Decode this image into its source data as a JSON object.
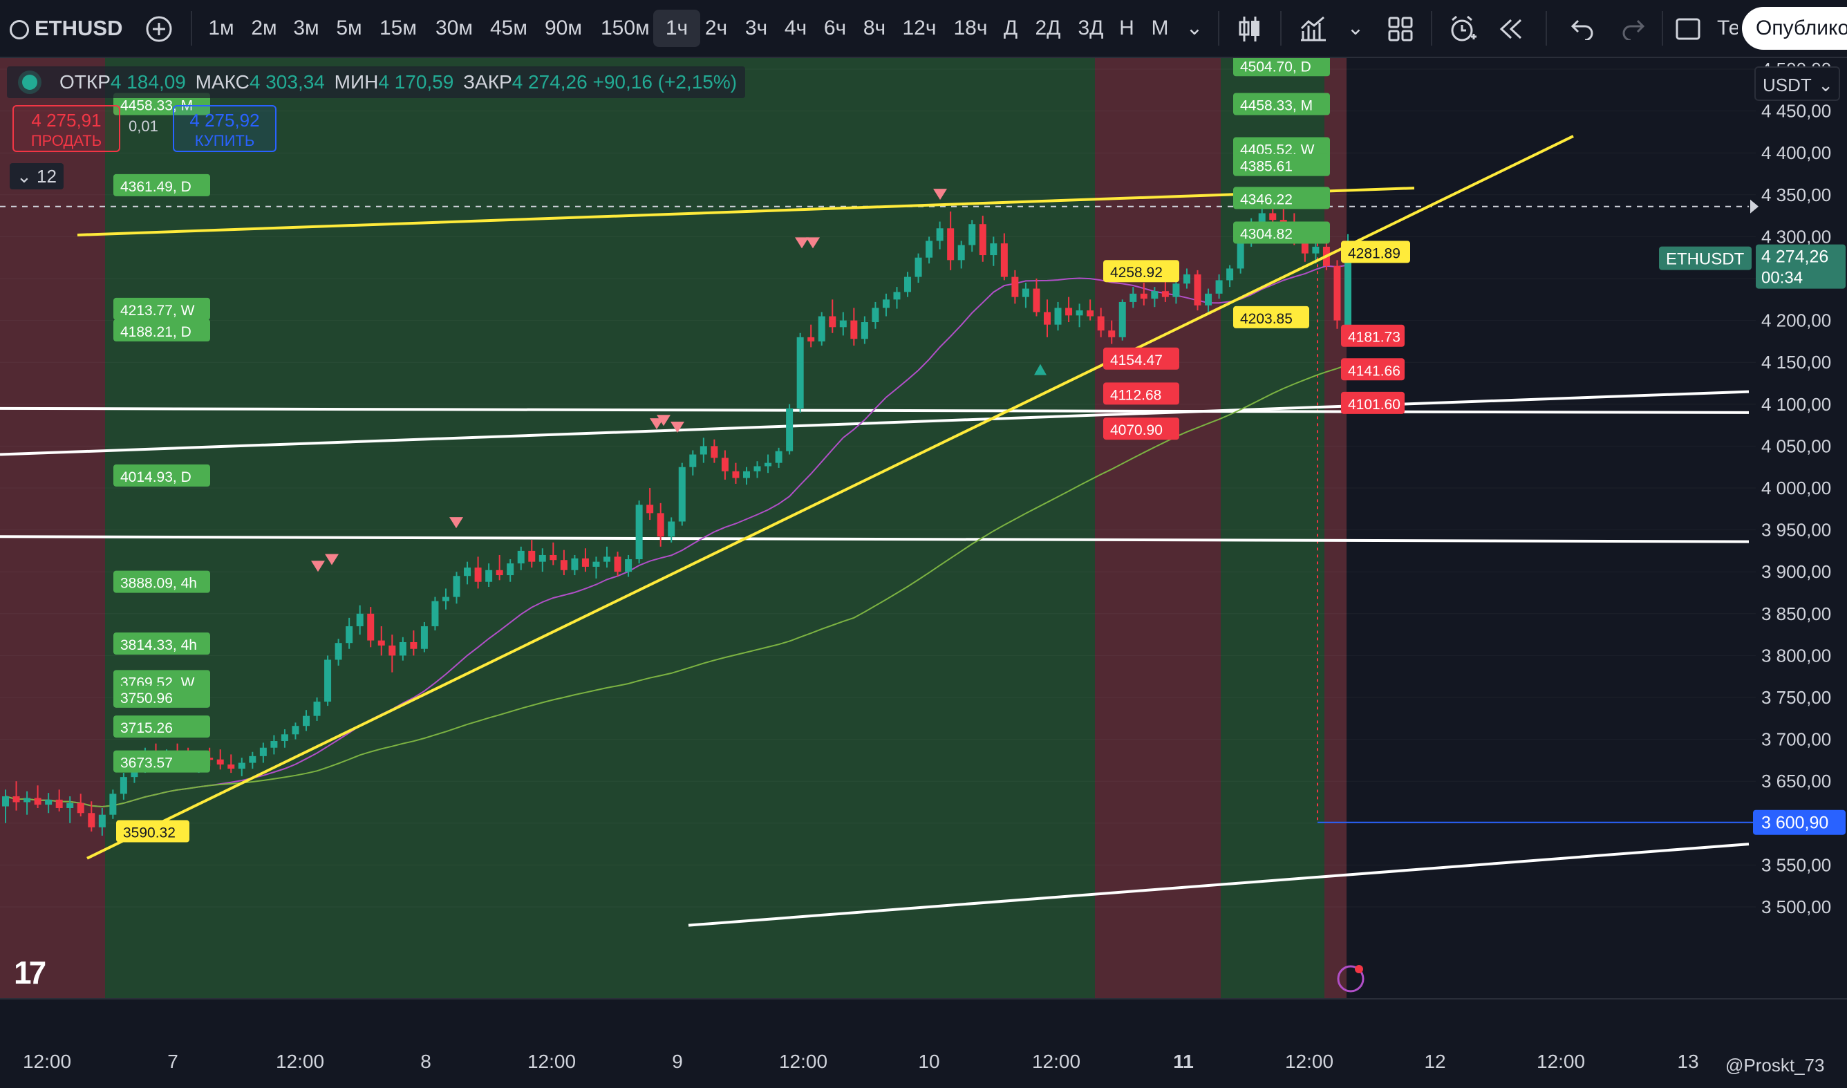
{
  "toolbar": {
    "symbol": "ETHUSD",
    "add_symbol_icon": "plus-circle-icon",
    "intervals": [
      "1м",
      "2м",
      "3м",
      "5м",
      "15м",
      "30м",
      "45м",
      "90м",
      "150м",
      "1ч",
      "2ч",
      "3ч",
      "4ч",
      "6ч",
      "8ч",
      "12ч",
      "18ч",
      "Д",
      "2Д",
      "3Д",
      "Н",
      "М"
    ],
    "active_interval": "1ч",
    "interval_dropdown_icon": "chevron-down-icon",
    "chart_type_icon": "candles-icon",
    "indicators_icon": "indicators-icon",
    "layout_icon": "grid-layout-icon",
    "alert_icon": "alarm-plus-icon",
    "replay_icon": "rewind-icon",
    "undo_icon": "undo-icon",
    "redo_icon": "redo-icon",
    "fullscreen_icon": "square-icon",
    "truncated_label": "Те",
    "publish_label": "Опубликовать"
  },
  "legend": {
    "open_label": "ОТКР",
    "open": "4 184,09",
    "high_label": "МАКС",
    "high": "4 303,34",
    "low_label": "МИН",
    "low": "4 170,59",
    "close_label": "ЗАКР",
    "close": "4 274,26",
    "change": "+90,16 (+2,15%)"
  },
  "trade": {
    "sell_price": "4 275,91",
    "sell_label": "ПРОДАТЬ",
    "lot": "0,01",
    "buy_price": "4 275,92",
    "buy_label": "КУПИТЬ"
  },
  "indicators_toggle": "12",
  "currency": "USDT",
  "watermark": "@Proskt_73",
  "colors": {
    "bg": "#131722",
    "up": "#22ab94",
    "down": "#f23645",
    "trendline": "#ffeb3b",
    "level": "#ffffff",
    "zone_green": "#244a30",
    "zone_red": "#5a2b35",
    "label_green": "#4caf50",
    "label_red": "#f23645",
    "label_yellow": "#ffeb3b",
    "ma_purple": "#b14fc8",
    "ma_green": "#7cb342",
    "blue_line": "#2962ff"
  },
  "chart_data": {
    "type": "candlestick",
    "symbol": "ETHUSD",
    "interval": "1ч",
    "ylim": [
      3480,
      4530
    ],
    "y_ticks": [
      "4 500,00",
      "4 450,00",
      "4 400,00",
      "4 350,00",
      "4 300,00",
      "4 250,00",
      "4 200,00",
      "4 150,00",
      "4 100,00",
      "4 050,00",
      "4 000,00",
      "3 950,00",
      "3 900,00",
      "3 850,00",
      "3 800,00",
      "3 750,00",
      "3 700,00",
      "3 650,00",
      "3 600,00",
      "3 550,00",
      "3 500,00"
    ],
    "x_ticks": [
      "12:00",
      "7",
      "12:00",
      "8",
      "12:00",
      "9",
      "12:00",
      "10",
      "12:00",
      "11",
      "12:00",
      "12",
      "12:00",
      "13"
    ],
    "current_price": {
      "symbol": "ETHUSDT",
      "value": "4 274,26",
      "timer": "00:34"
    },
    "blue_level": {
      "value": 3600.9,
      "label": "3 600,90"
    },
    "dashed_level": 4336,
    "level_labels_green_left": [
      {
        "text": "4458.33, M",
        "value": 4458.33
      },
      {
        "text": "4361.49, D",
        "value": 4361.49
      },
      {
        "text": "4213.77, W",
        "value": 4213.77
      },
      {
        "text": "4188.21, D",
        "value": 4188.21
      },
      {
        "text": "4014.93, D",
        "value": 4014.93
      },
      {
        "text": "3888.09, 4h",
        "value": 3888.09
      },
      {
        "text": "3814.33, 4h",
        "value": 3814.33
      },
      {
        "text": "3769.52, W",
        "value": 3769.52
      },
      {
        "text": "3750.96",
        "value": 3750.96
      },
      {
        "text": "3715.26",
        "value": 3715.26
      },
      {
        "text": "3673.57",
        "value": 3673.57
      }
    ],
    "level_labels_green_right": [
      {
        "text": "4504.70, D",
        "value": 4504.7
      },
      {
        "text": "4458.33, M",
        "value": 4458.33
      },
      {
        "text": "4405.52, W",
        "value": 4405.52
      },
      {
        "text": "4385.61",
        "value": 4385.61
      },
      {
        "text": "4346.22",
        "value": 4346.22
      },
      {
        "text": "4304.82",
        "value": 4304.82
      }
    ],
    "level_labels_yellow": [
      {
        "text": "3590.32",
        "value": 3590.32
      },
      {
        "text": "4258.92",
        "value": 4258.92
      },
      {
        "text": "4203.85",
        "value": 4203.85
      },
      {
        "text": "4281.89",
        "value": 4281.89
      }
    ],
    "level_labels_red": [
      {
        "text": "4154.47",
        "value": 4154.47
      },
      {
        "text": "4112.68",
        "value": 4112.68
      },
      {
        "text": "4070.90",
        "value": 4070.9
      },
      {
        "text": "4181.73",
        "value": 4181.73
      },
      {
        "text": "4141.66",
        "value": 4141.66
      },
      {
        "text": "4101.60",
        "value": 4101.6
      }
    ],
    "candles": [
      [
        3620,
        3640,
        3600,
        3632
      ],
      [
        3632,
        3650,
        3615,
        3625
      ],
      [
        3625,
        3638,
        3610,
        3630
      ],
      [
        3630,
        3645,
        3618,
        3622
      ],
      [
        3622,
        3636,
        3612,
        3628
      ],
      [
        3628,
        3640,
        3614,
        3618
      ],
      [
        3618,
        3632,
        3600,
        3624
      ],
      [
        3624,
        3635,
        3608,
        3612
      ],
      [
        3612,
        3626,
        3590,
        3595
      ],
      [
        3595,
        3618,
        3585,
        3610
      ],
      [
        3610,
        3640,
        3605,
        3635
      ],
      [
        3635,
        3660,
        3628,
        3655
      ],
      [
        3655,
        3680,
        3648,
        3672
      ],
      [
        3672,
        3690,
        3660,
        3680
      ],
      [
        3680,
        3695,
        3666,
        3674
      ],
      [
        3674,
        3688,
        3665,
        3684
      ],
      [
        3684,
        3695,
        3672,
        3678
      ],
      [
        3678,
        3690,
        3662,
        3670
      ],
      [
        3670,
        3684,
        3660,
        3678
      ],
      [
        3678,
        3690,
        3668,
        3676
      ],
      [
        3676,
        3688,
        3664,
        3670
      ],
      [
        3670,
        3682,
        3660,
        3665
      ],
      [
        3665,
        3678,
        3656,
        3672
      ],
      [
        3672,
        3685,
        3665,
        3680
      ],
      [
        3680,
        3696,
        3672,
        3690
      ],
      [
        3690,
        3705,
        3682,
        3698
      ],
      [
        3698,
        3712,
        3690,
        3706
      ],
      [
        3706,
        3720,
        3700,
        3716
      ],
      [
        3716,
        3735,
        3710,
        3728
      ],
      [
        3728,
        3750,
        3722,
        3745
      ],
      [
        3745,
        3800,
        3740,
        3795
      ],
      [
        3795,
        3820,
        3788,
        3815
      ],
      [
        3815,
        3845,
        3808,
        3835
      ],
      [
        3835,
        3860,
        3825,
        3850
      ],
      [
        3850,
        3858,
        3810,
        3818
      ],
      [
        3818,
        3835,
        3800,
        3812
      ],
      [
        3812,
        3825,
        3780,
        3800
      ],
      [
        3800,
        3822,
        3794,
        3816
      ],
      [
        3816,
        3830,
        3800,
        3808
      ],
      [
        3808,
        3840,
        3804,
        3835
      ],
      [
        3835,
        3870,
        3830,
        3865
      ],
      [
        3865,
        3880,
        3855,
        3870
      ],
      [
        3870,
        3900,
        3862,
        3895
      ],
      [
        3895,
        3912,
        3885,
        3905
      ],
      [
        3905,
        3918,
        3880,
        3888
      ],
      [
        3888,
        3910,
        3882,
        3902
      ],
      [
        3902,
        3920,
        3890,
        3896
      ],
      [
        3896,
        3915,
        3888,
        3910
      ],
      [
        3910,
        3930,
        3902,
        3925
      ],
      [
        3925,
        3938,
        3905,
        3912
      ],
      [
        3912,
        3928,
        3900,
        3920
      ],
      [
        3920,
        3935,
        3908,
        3914
      ],
      [
        3914,
        3926,
        3896,
        3902
      ],
      [
        3902,
        3920,
        3896,
        3916
      ],
      [
        3916,
        3928,
        3900,
        3906
      ],
      [
        3906,
        3918,
        3892,
        3912
      ],
      [
        3912,
        3930,
        3905,
        3918
      ],
      [
        3918,
        3924,
        3895,
        3900
      ],
      [
        3900,
        3920,
        3894,
        3915
      ],
      [
        3915,
        3985,
        3910,
        3980
      ],
      [
        3980,
        4000,
        3962,
        3970
      ],
      [
        3970,
        3982,
        3930,
        3942
      ],
      [
        3942,
        3965,
        3935,
        3960
      ],
      [
        3960,
        4030,
        3955,
        4025
      ],
      [
        4025,
        4045,
        4015,
        4040
      ],
      [
        4040,
        4060,
        4030,
        4050
      ],
      [
        4050,
        4058,
        4030,
        4036
      ],
      [
        4036,
        4045,
        4010,
        4020
      ],
      [
        4020,
        4030,
        4005,
        4012
      ],
      [
        4012,
        4025,
        4004,
        4020
      ],
      [
        4020,
        4032,
        4012,
        4026
      ],
      [
        4026,
        4040,
        4018,
        4030
      ],
      [
        4030,
        4048,
        4024,
        4044
      ],
      [
        4044,
        4100,
        4040,
        4095
      ],
      [
        4095,
        4185,
        4090,
        4180
      ],
      [
        4180,
        4195,
        4168,
        4175
      ],
      [
        4175,
        4210,
        4170,
        4205
      ],
      [
        4205,
        4225,
        4185,
        4192
      ],
      [
        4192,
        4210,
        4182,
        4200
      ],
      [
        4200,
        4215,
        4170,
        4178
      ],
      [
        4178,
        4205,
        4172,
        4198
      ],
      [
        4198,
        4222,
        4190,
        4215
      ],
      [
        4215,
        4232,
        4205,
        4225
      ],
      [
        4225,
        4240,
        4214,
        4234
      ],
      [
        4234,
        4258,
        4228,
        4252
      ],
      [
        4252,
        4280,
        4245,
        4275
      ],
      [
        4275,
        4300,
        4268,
        4295
      ],
      [
        4295,
        4318,
        4285,
        4310
      ],
      [
        4310,
        4330,
        4260,
        4272
      ],
      [
        4272,
        4295,
        4262,
        4290
      ],
      [
        4290,
        4320,
        4282,
        4315
      ],
      [
        4315,
        4325,
        4270,
        4278
      ],
      [
        4278,
        4300,
        4265,
        4292
      ],
      [
        4292,
        4304,
        4248,
        4252
      ],
      [
        4252,
        4260,
        4220,
        4228
      ],
      [
        4228,
        4245,
        4215,
        4238
      ],
      [
        4238,
        4250,
        4205,
        4210
      ],
      [
        4210,
        4225,
        4180,
        4195
      ],
      [
        4195,
        4222,
        4188,
        4215
      ],
      [
        4215,
        4228,
        4198,
        4206
      ],
      [
        4206,
        4220,
        4192,
        4212
      ],
      [
        4212,
        4225,
        4200,
        4205
      ],
      [
        4205,
        4215,
        4180,
        4188
      ],
      [
        4188,
        4200,
        4172,
        4180
      ],
      [
        4180,
        4225,
        4176,
        4222
      ],
      [
        4222,
        4240,
        4215,
        4232
      ],
      [
        4232,
        4245,
        4218,
        4226
      ],
      [
        4226,
        4240,
        4216,
        4235
      ],
      [
        4235,
        4248,
        4222,
        4228
      ],
      [
        4228,
        4250,
        4220,
        4244
      ],
      [
        4244,
        4262,
        4238,
        4255
      ],
      [
        4255,
        4260,
        4212,
        4218
      ],
      [
        4218,
        4238,
        4210,
        4232
      ],
      [
        4232,
        4255,
        4226,
        4248
      ],
      [
        4248,
        4266,
        4240,
        4262
      ],
      [
        4262,
        4300,
        4256,
        4295
      ],
      [
        4295,
        4322,
        4288,
        4316
      ],
      [
        4316,
        4335,
        4305,
        4328
      ],
      [
        4328,
        4342,
        4314,
        4320
      ],
      [
        4320,
        4336,
        4306,
        4312
      ],
      [
        4312,
        4328,
        4290,
        4296
      ],
      [
        4296,
        4310,
        4270,
        4280
      ],
      [
        4280,
        4295,
        4268,
        4288
      ],
      [
        4288,
        4300,
        4260,
        4265
      ],
      [
        4265,
        4272,
        4190,
        4200
      ],
      [
        4184,
        4303,
        4171,
        4274
      ]
    ]
  }
}
